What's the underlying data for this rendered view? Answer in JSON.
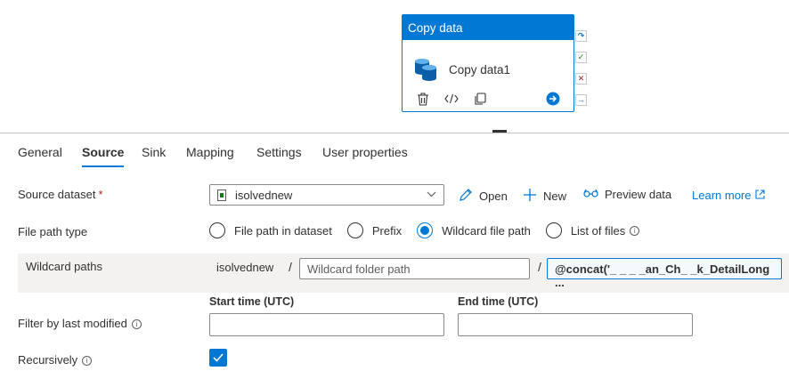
{
  "activity": {
    "header": "Copy data",
    "name": "Copy data1"
  },
  "tabs": [
    {
      "label": "General"
    },
    {
      "label": "Source"
    },
    {
      "label": "Sink"
    },
    {
      "label": "Mapping"
    },
    {
      "label": "Settings"
    },
    {
      "label": "User properties"
    }
  ],
  "active_tab": "Source",
  "source_dataset": {
    "label": "Source dataset",
    "required_mark": "*",
    "value": "isolvednew",
    "open_label": "Open",
    "new_label": "New",
    "preview_label": "Preview data",
    "learn_more_label": "Learn more"
  },
  "file_path_type": {
    "label": "File path type",
    "options": [
      {
        "label": "File path in dataset"
      },
      {
        "label": "Prefix"
      },
      {
        "label": "Wildcard file path"
      },
      {
        "label": "List of files"
      }
    ],
    "selected": "Wildcard file path"
  },
  "wildcard_paths": {
    "label": "Wildcard paths",
    "root": "isolvednew",
    "separator": "/",
    "folder_placeholder": "Wildcard folder path",
    "file_expression": "@concat('_ _ _ _an_Ch_ _k_DetailLong ..."
  },
  "filter": {
    "label": "Filter by last modified",
    "start_label": "Start time (UTC)",
    "end_label": "End time (UTC)",
    "start_value": "",
    "end_value": ""
  },
  "recursively": {
    "label": "Recursively",
    "checked": true
  },
  "colors": {
    "accent": "#0078d4",
    "success": "#107c10",
    "error": "#a4262c"
  }
}
